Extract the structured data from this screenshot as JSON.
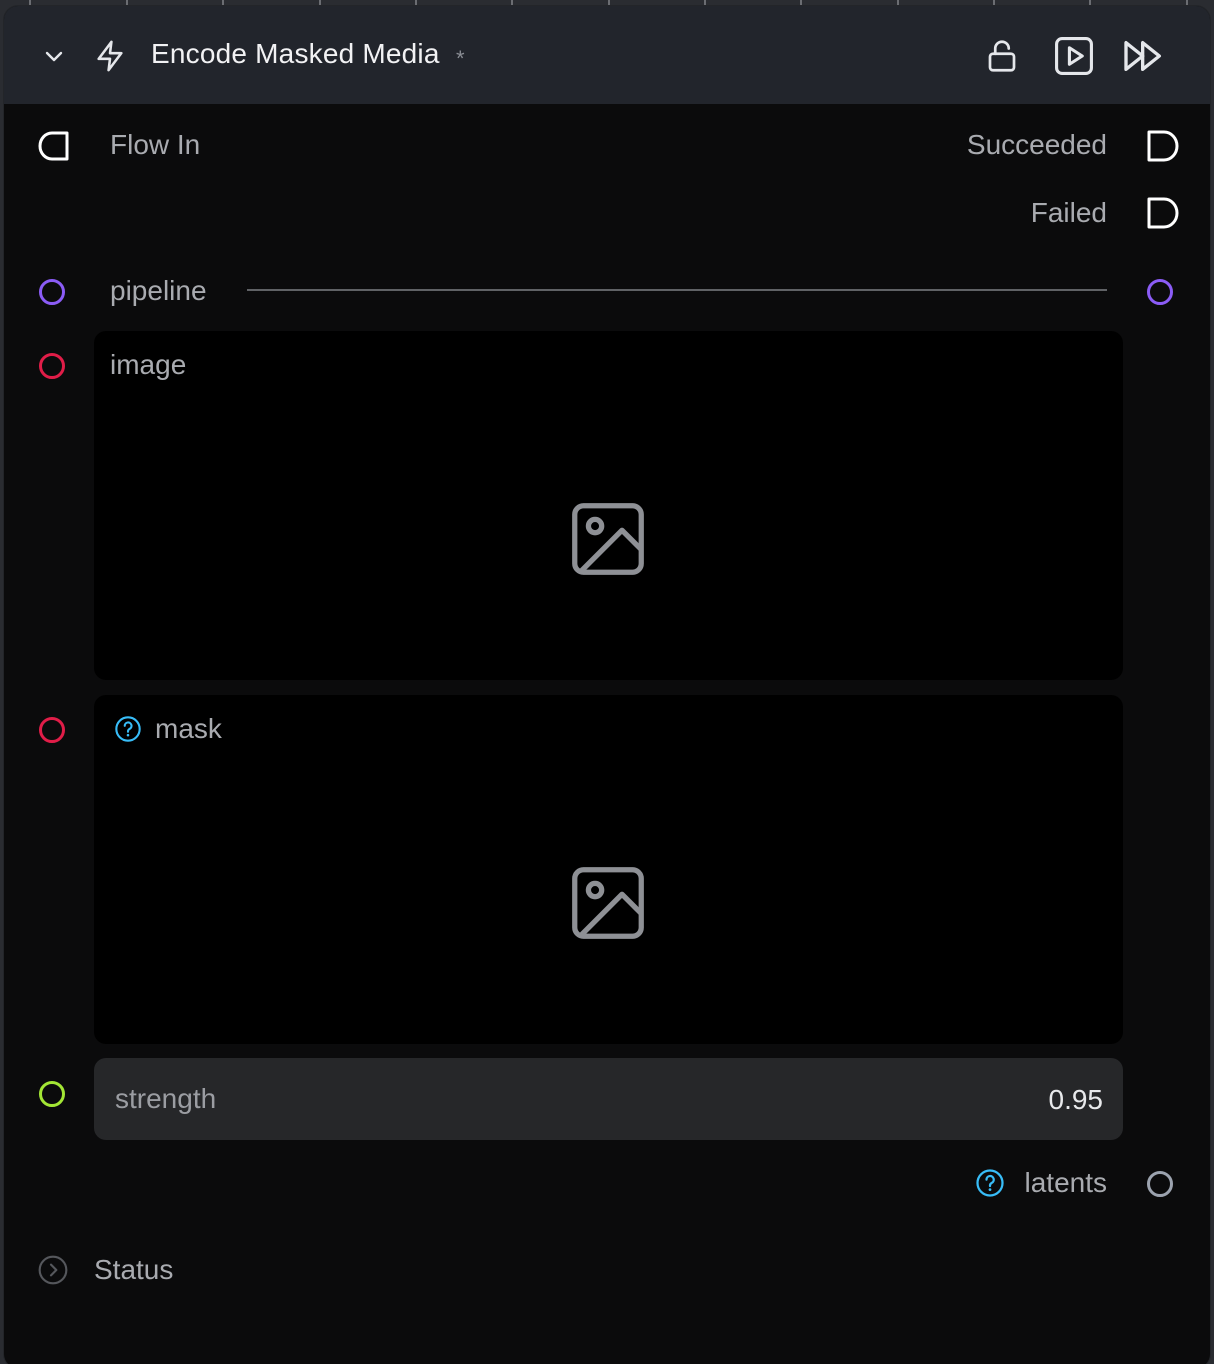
{
  "node": {
    "title": "Encode Masked Media",
    "modified_marker": "*"
  },
  "toolbar": {
    "icons": [
      "chevron-down-icon",
      "lightning-icon",
      "unlock-icon",
      "play-icon",
      "fast-forward-icon"
    ]
  },
  "flow": {
    "input_label": "Flow In",
    "outputs": [
      "Succeeded",
      "Failed"
    ]
  },
  "params": {
    "pipeline": {
      "label": "pipeline",
      "port_color": "#8b5cf6"
    },
    "image": {
      "label": "image",
      "port_color": "#e11d48"
    },
    "mask": {
      "label": "mask",
      "port_color": "#e11d48"
    },
    "strength": {
      "label": "strength",
      "value": "0.95",
      "port_color": "#a3e635"
    }
  },
  "outputs": {
    "latents": {
      "label": "latents",
      "port_color": "#9ca3af"
    }
  },
  "status": {
    "label": "Status"
  },
  "colors": {
    "header_bg": "#22252c",
    "node_bg": "#0b0b0c",
    "help_icon": "#38bdf8",
    "field_bg": "#262729"
  }
}
